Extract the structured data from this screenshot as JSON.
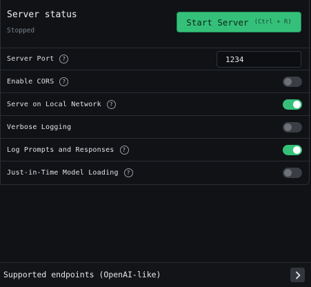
{
  "server": {
    "title": "Server status",
    "status": "Stopped",
    "start_label": "Start Server",
    "start_shortcut": "(Ctrl + R)"
  },
  "settings": {
    "port": {
      "label": "Server Port",
      "value": "1234"
    },
    "items": [
      {
        "label": "Enable CORS",
        "enabled": false
      },
      {
        "label": "Serve on Local Network",
        "enabled": true
      },
      {
        "label": "Verbose Logging",
        "enabled": false
      },
      {
        "label": "Log Prompts and Responses",
        "enabled": true
      },
      {
        "label": "Just-in-Time Model Loading",
        "enabled": false
      }
    ],
    "help_glyph": "?"
  },
  "footer": {
    "label": "Supported endpoints (OpenAI-like)"
  },
  "colors": {
    "accent": "#35c07a",
    "background": "#101216",
    "toggle_off": "#3a3e44"
  }
}
